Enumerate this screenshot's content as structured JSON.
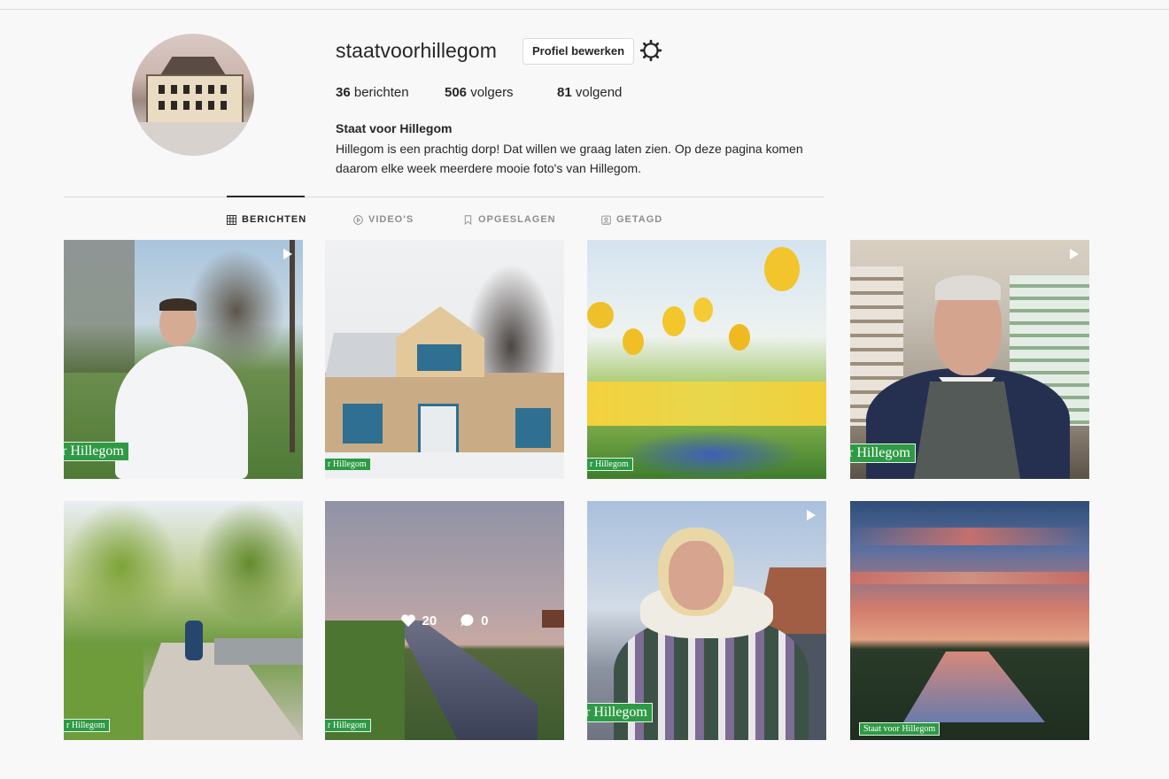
{
  "profile": {
    "username": "staatvoorhillegom",
    "edit_button": "Profiel bewerken",
    "settings_icon": "gear-icon",
    "stats": {
      "posts_count": "36",
      "posts_label": "berichten",
      "followers_count": "506",
      "followers_label": "volgers",
      "following_count": "81",
      "following_label": "volgend"
    },
    "full_name": "Staat voor Hillegom",
    "bio": "Hillegom is een prachtig dorp! Dat willen we graag laten zien. Op deze pagina komen daarom elke week meerdere mooie foto's van Hillegom."
  },
  "tabs": [
    {
      "label": "BERICHTEN",
      "icon": "grid-icon",
      "active": true
    },
    {
      "label": "VIDEO'S",
      "icon": "play-circle-icon",
      "active": false
    },
    {
      "label": "OPGESLAGEN",
      "icon": "bookmark-icon",
      "active": false
    },
    {
      "label": "GETAGD",
      "icon": "tagged-user-icon",
      "active": false
    }
  ],
  "posts": [
    {
      "subject": "young man in white hoodie in park",
      "tag": "r Hillegom",
      "video": true
    },
    {
      "subject": "snowy wooden house with blue trim",
      "tag": "r Hillegom",
      "video": false
    },
    {
      "subject": "yellow tulips and blue flowers",
      "tag": "r Hillegom",
      "video": false
    },
    {
      "subject": "elderly man in pharmacy shop",
      "tag": "r Hillegom",
      "video": true
    },
    {
      "subject": "tree-lined path with children skating",
      "tag": "r Hillegom",
      "video": false
    },
    {
      "subject": "canal at dusk in meadow",
      "tag": "r Hillegom",
      "video": false,
      "likes": "20",
      "comments": "0"
    },
    {
      "subject": "smiling woman with scarf by canal",
      "tag": "r Hillegom",
      "video": true
    },
    {
      "subject": "red clouds reflected in ditch at sunset",
      "tag": "Staat voor Hillegom",
      "video": false
    }
  ]
}
